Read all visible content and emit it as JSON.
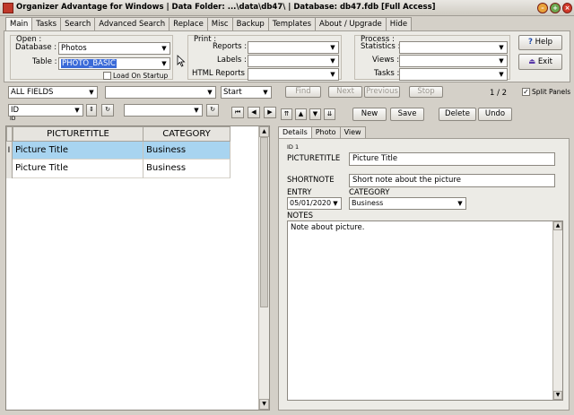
{
  "window": {
    "title": "Organizer Advantage for Windows | Data Folder: ...\\data\\db47\\ | Database: db47.fdb [Full Access]"
  },
  "tabs": [
    "Main",
    "Tasks",
    "Search",
    "Advanced Search",
    "Replace",
    "Misc",
    "Backup",
    "Templates",
    "About / Upgrade",
    "Hide"
  ],
  "open": {
    "legend": "Open :",
    "database_label": "Database :",
    "database_value": "Photos",
    "table_label": "Table :",
    "table_value": "PHOTO_BASIC",
    "load_on_startup": "Load On Startup"
  },
  "print": {
    "legend": "Print :",
    "reports": "Reports :",
    "labels": "Labels :",
    "html_reports": "HTML Reports :"
  },
  "process": {
    "legend": "Process :",
    "statistics": "Statistics :",
    "views": "Views :",
    "tasks": "Tasks :"
  },
  "help_label": "Help",
  "exit_label": "Exit",
  "search": {
    "field_filter": "ALL FIELDS",
    "search_value": "",
    "match_mode": "Start",
    "find": "Find",
    "next": "Next",
    "previous": "Previous",
    "stop": "Stop",
    "record_count": "1 / 2",
    "split_panels": "Split Panels"
  },
  "sort": {
    "field": "ID",
    "sub_label": "ID",
    "second_field": ""
  },
  "grid": {
    "columns": [
      "PICTURETITLE",
      "CATEGORY"
    ],
    "rows": [
      [
        "Picture Title",
        "Business"
      ],
      [
        "Picture Title",
        "Business"
      ]
    ],
    "row_indicator": "I"
  },
  "record_toolbar": {
    "new": "New",
    "save": "Save",
    "delete": "Delete",
    "undo": "Undo"
  },
  "detail_tabs": [
    "Details",
    "Photo",
    "View"
  ],
  "details": {
    "id_label": "ID 1",
    "picturetitle_label": "PICTURETITLE",
    "picturetitle_value": "Picture Title",
    "shortnote_label": "SHORTNOTE",
    "shortnote_value": "Short note about the picture",
    "entry_label": "ENTRY",
    "entry_value": "05/01/2020",
    "category_label": "CATEGORY",
    "category_value": "Business",
    "notes_label": "NOTES",
    "notes_value": "Note about picture."
  },
  "colors": {
    "selected_row": "#a8d4f0",
    "combo_highlight": "#3a6ad8"
  }
}
